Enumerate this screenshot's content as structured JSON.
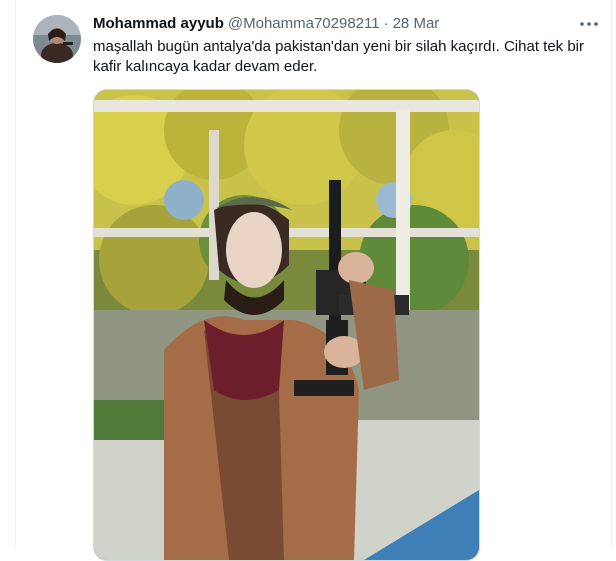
{
  "tweet": {
    "display_name": "Mohammad ayyub",
    "handle": "@Mohamma70298211",
    "separator": "·",
    "date": "28 Mar",
    "text": "maşallah bugün antalya'da pakistan'dan yeni bir silah kaçırdı. Cihat tek bir\nkafir kalıncaya kadar devam eder.",
    "more_icon": "more-horizontal-icon"
  },
  "colors": {
    "name": "#0f1419",
    "muted": "#536471",
    "border": "#cfd9de"
  }
}
